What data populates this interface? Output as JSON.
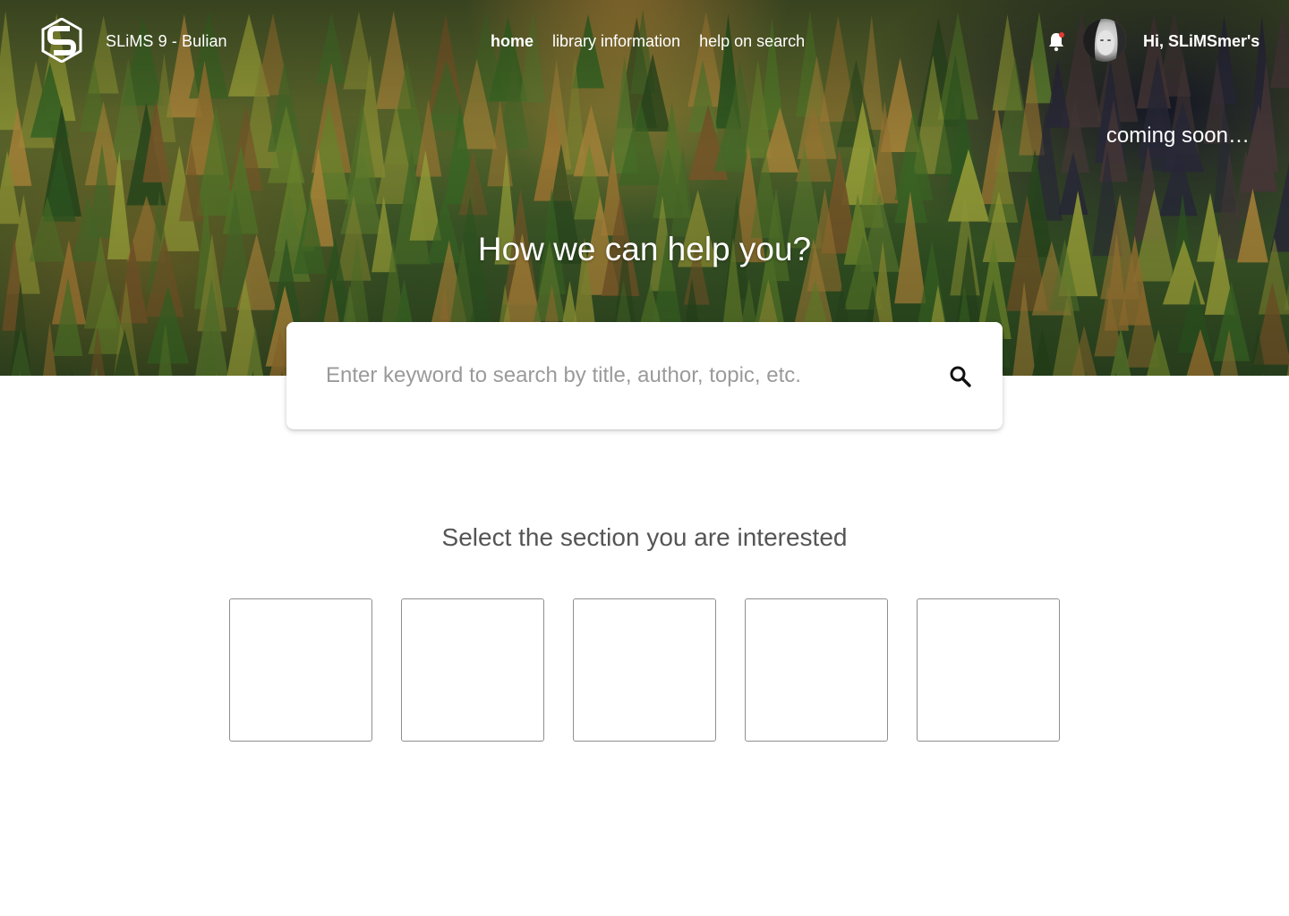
{
  "brand": {
    "name": "SLiMS 9 - Bulian",
    "logo_icon": "slims-logo-icon"
  },
  "nav": {
    "items": [
      {
        "label": "home",
        "active": true
      },
      {
        "label": "library information",
        "active": false
      },
      {
        "label": "help on search",
        "active": false
      }
    ]
  },
  "user": {
    "greeting": "Hi, SLiMSmer's",
    "notification_icon": "bell-icon",
    "has_unread": true,
    "notification_dot_color": "#e53935"
  },
  "hero": {
    "coming_soon": "coming soon…",
    "headline": "How we can help you?"
  },
  "search": {
    "placeholder": "Enter keyword to search by title, author, topic, etc.",
    "value": "",
    "icon": "search-icon"
  },
  "sections": {
    "title": "Select the section you are interested",
    "tiles": [
      {},
      {},
      {},
      {},
      {}
    ]
  }
}
